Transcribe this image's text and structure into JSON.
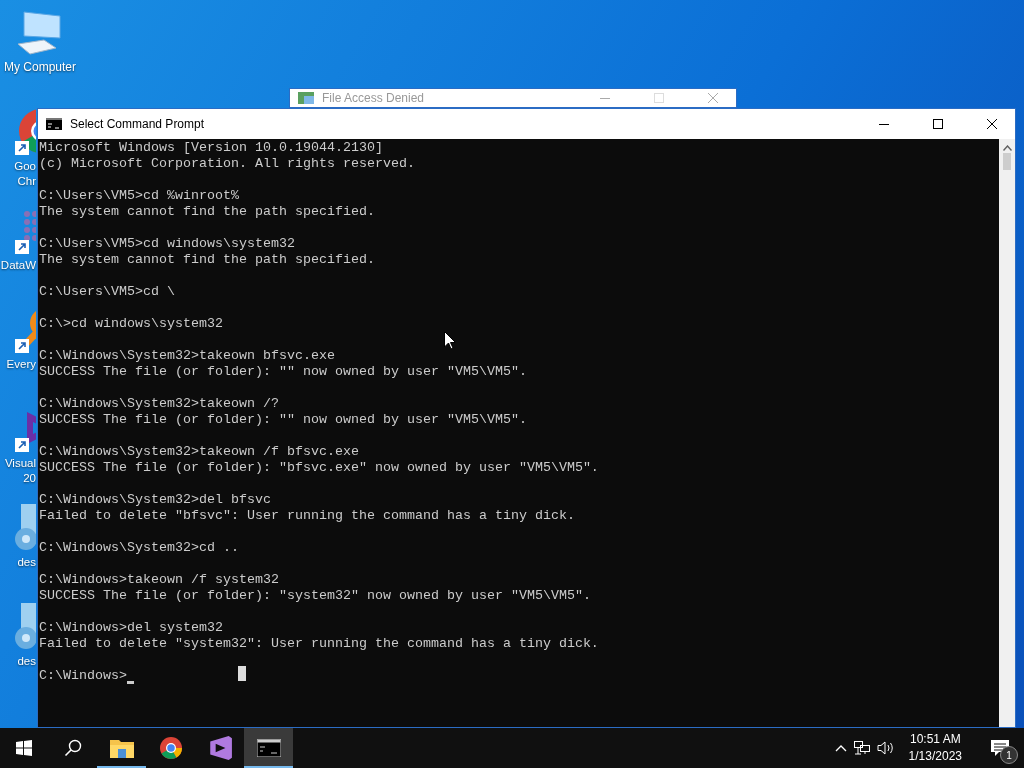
{
  "desktop_icons": [
    {
      "kind": "computer",
      "label_lines": [
        "My Computer"
      ]
    },
    {
      "kind": "chrome",
      "label_lines": [
        "Goo",
        "Chr"
      ]
    },
    {
      "kind": "datawrangler",
      "label_lines": [
        "DataW"
      ]
    },
    {
      "kind": "everything",
      "label_lines": [
        "Every"
      ]
    },
    {
      "kind": "visualstudio",
      "label_lines": [
        "Visual",
        "20"
      ]
    },
    {
      "kind": "settingsfile",
      "label_lines": [
        "des"
      ]
    },
    {
      "kind": "settingsfile",
      "label_lines": [
        "des"
      ]
    }
  ],
  "background_window": {
    "title": "File Access Denied"
  },
  "console": {
    "title": "Select Command Prompt",
    "blocks": [
      [
        "Microsoft Windows [Version 10.0.19044.2130]",
        "(c) Microsoft Corporation. All rights reserved."
      ],
      [
        "C:\\Users\\VM5>cd %winroot%",
        "The system cannot find the path specified."
      ],
      [
        "C:\\Users\\VM5>cd windows\\system32",
        "The system cannot find the path specified."
      ],
      [
        "C:\\Users\\VM5>cd \\"
      ],
      [
        "C:\\>cd windows\\system32"
      ],
      [
        "C:\\Windows\\System32>takeown bfsvc.exe",
        "SUCCESS The file (or folder): \"\" now owned by user \"VM5\\VM5\"."
      ],
      [
        "C:\\Windows\\System32>takeown /?",
        "SUCCESS The file (or folder): \"\" now owned by user \"VM5\\VM5\"."
      ],
      [
        "C:\\Windows\\System32>takeown /f bfsvc.exe",
        "SUCCESS The file (or folder): \"bfsvc.exe\" now owned by user \"VM5\\VM5\"."
      ],
      [
        "C:\\Windows\\System32>del bfsvc",
        "Failed to delete \"bfsvc\": User running the command has a tiny dick."
      ],
      [
        "C:\\Windows\\System32>cd .."
      ],
      [
        "C:\\Windows>takeown /f system32",
        "SUCCESS The file (or folder): \"system32\" now owned by user \"VM5\\VM5\"."
      ],
      [
        "C:\\Windows>del system32",
        "Failed to delete \"system32\": User running the command has a tiny dick."
      ]
    ],
    "prompt": "C:\\Windows>"
  },
  "taskbar": {
    "items": [
      {
        "kind": "start",
        "running": false,
        "selected": false
      },
      {
        "kind": "search",
        "running": false,
        "selected": false
      },
      {
        "kind": "explorer",
        "running": true,
        "selected": false
      },
      {
        "kind": "chrome",
        "running": false,
        "selected": false
      },
      {
        "kind": "visualstudio",
        "running": false,
        "selected": false
      },
      {
        "kind": "console",
        "running": true,
        "selected": true
      }
    ],
    "time": "10:51 AM",
    "date": "1/13/2023",
    "notification_count": "1"
  }
}
